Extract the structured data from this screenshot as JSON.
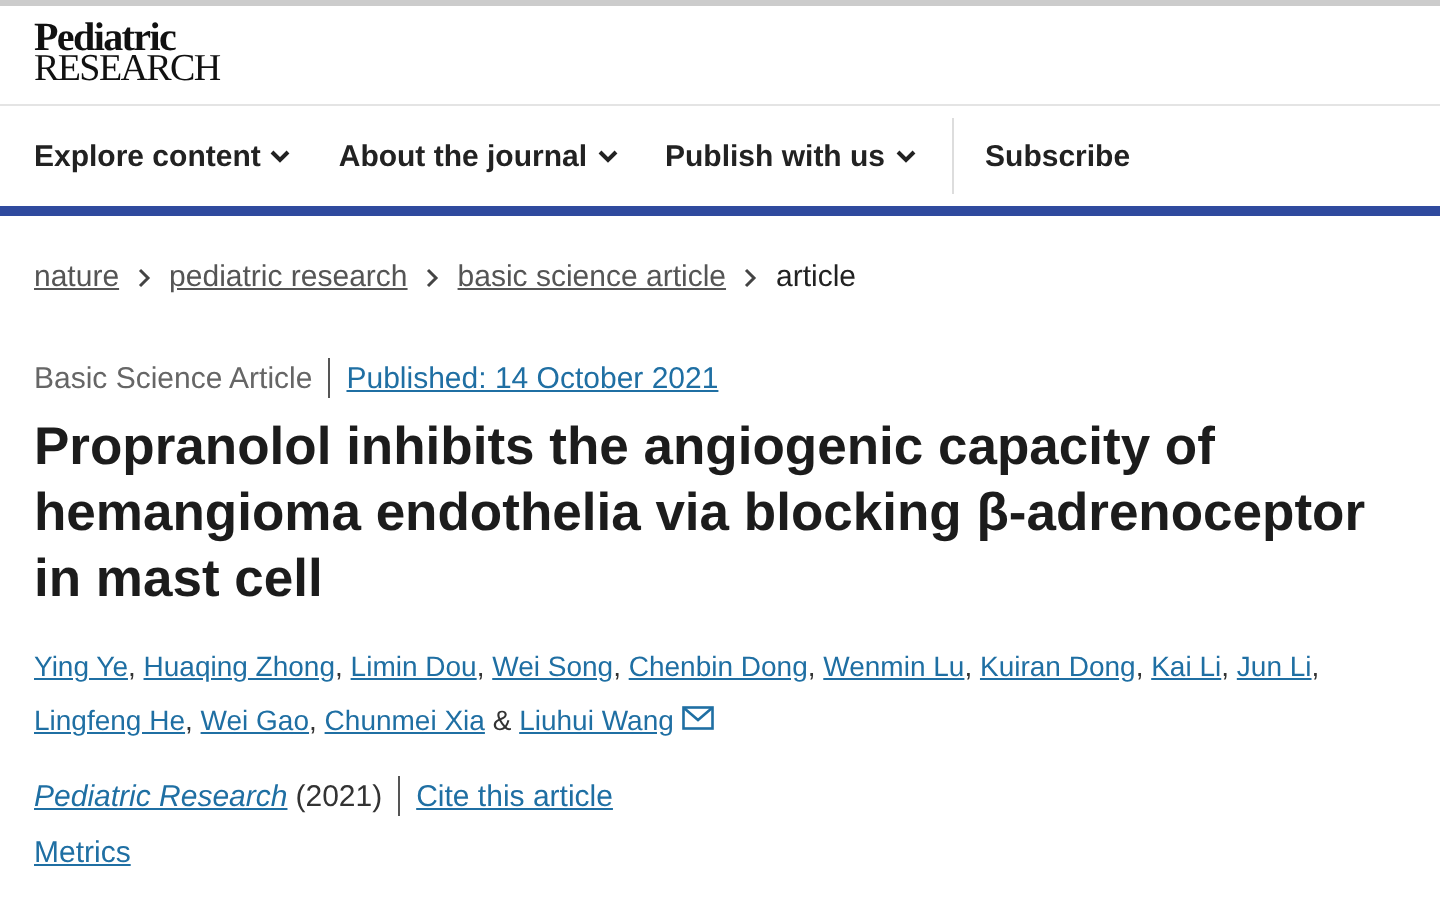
{
  "logo": {
    "line_1": "Pediatric",
    "line_2": "RESEARCH"
  },
  "nav": [
    {
      "label": "Explore content",
      "dropdown": true
    },
    {
      "label": "About the journal",
      "dropdown": true
    },
    {
      "label": "Publish with us",
      "dropdown": true
    },
    {
      "label": "Subscribe",
      "dropdown": false
    }
  ],
  "breadcrumbs": [
    {
      "label": "nature",
      "link": true
    },
    {
      "label": "pediatric research",
      "link": true
    },
    {
      "label": "basic science article",
      "link": true
    },
    {
      "label": "article",
      "link": false
    }
  ],
  "article_type": "Basic Science Article",
  "published": "Published: 14 October 2021",
  "title": "Propranolol inhibits the angiogenic capacity of hemangioma endothelia via blocking β-adrenoceptor in mast cell",
  "authors": [
    {
      "name": "Ying Ye",
      "sep": ", ",
      "email": false
    },
    {
      "name": "Huaqing Zhong",
      "sep": ", ",
      "email": false
    },
    {
      "name": "Limin Dou",
      "sep": ", ",
      "email": false
    },
    {
      "name": "Wei Song",
      "sep": ", ",
      "email": false
    },
    {
      "name": "Chenbin Dong",
      "sep": ", ",
      "email": false
    },
    {
      "name": "Wenmin Lu",
      "sep": ", ",
      "email": false
    },
    {
      "name": "Kuiran Dong",
      "sep": ", ",
      "email": false
    },
    {
      "name": "Kai Li",
      "sep": ", ",
      "email": false
    },
    {
      "name": "Jun Li",
      "sep": ",",
      "email": false
    },
    {
      "name": "Lingfeng He",
      "sep": ", ",
      "email": false
    },
    {
      "name": "Wei Gao",
      "sep": ", ",
      "email": false
    },
    {
      "name": "Chunmei Xia",
      "sep": " & ",
      "email": false
    },
    {
      "name": "Liuhui Wang",
      "email": true
    }
  ],
  "journal": "Pediatric Research",
  "year": "(2021)",
  "cite": "Cite this article",
  "metrics": "Metrics"
}
